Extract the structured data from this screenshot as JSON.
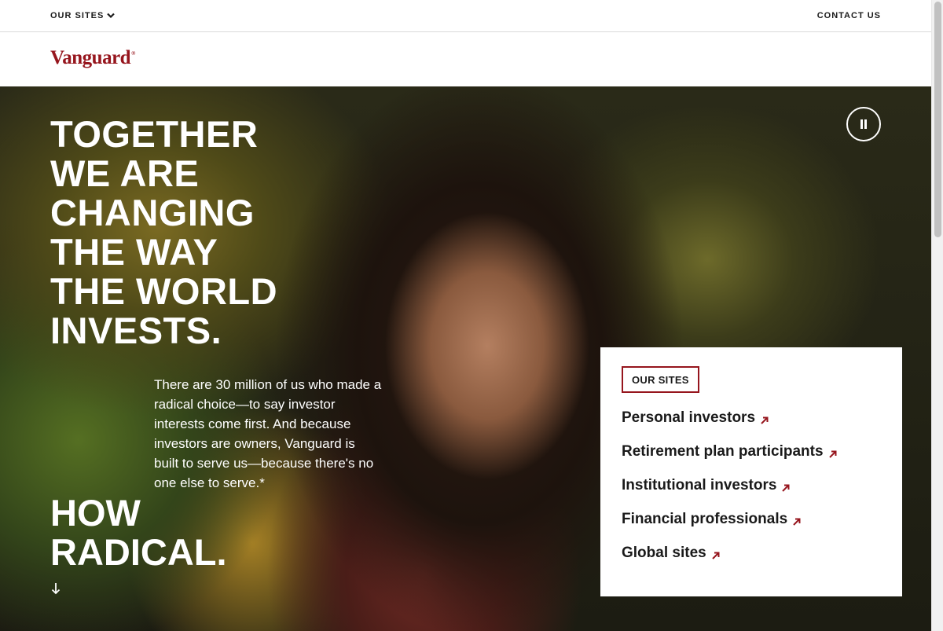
{
  "topbar": {
    "our_sites_label": "OUR SITES",
    "contact_label": "CONTACT US"
  },
  "brand": {
    "logo_text": "Vanguard",
    "logo_mark": "®",
    "color": "#96151d"
  },
  "hero": {
    "headline_lines": [
      "TOGETHER",
      "WE ARE",
      "CHANGING",
      "THE WAY",
      "THE WORLD",
      "INVESTS."
    ],
    "body": "There are 30 million of us who made a radical choice—to say investor interests come first. And because investors are owners, Vanguard is built to serve us—because there's no one else to serve.*",
    "tagline_lines": [
      "HOW",
      "RADICAL."
    ],
    "pause_icon": "pause-icon",
    "scroll_icon": "arrow-down-icon"
  },
  "sites_card": {
    "badge": "OUR SITES",
    "links": [
      {
        "label": "Personal investors"
      },
      {
        "label": "Retirement plan participants"
      },
      {
        "label": "Institutional investors"
      },
      {
        "label": "Financial professionals"
      },
      {
        "label": "Global sites"
      }
    ],
    "link_icon": "external-arrow-icon"
  }
}
